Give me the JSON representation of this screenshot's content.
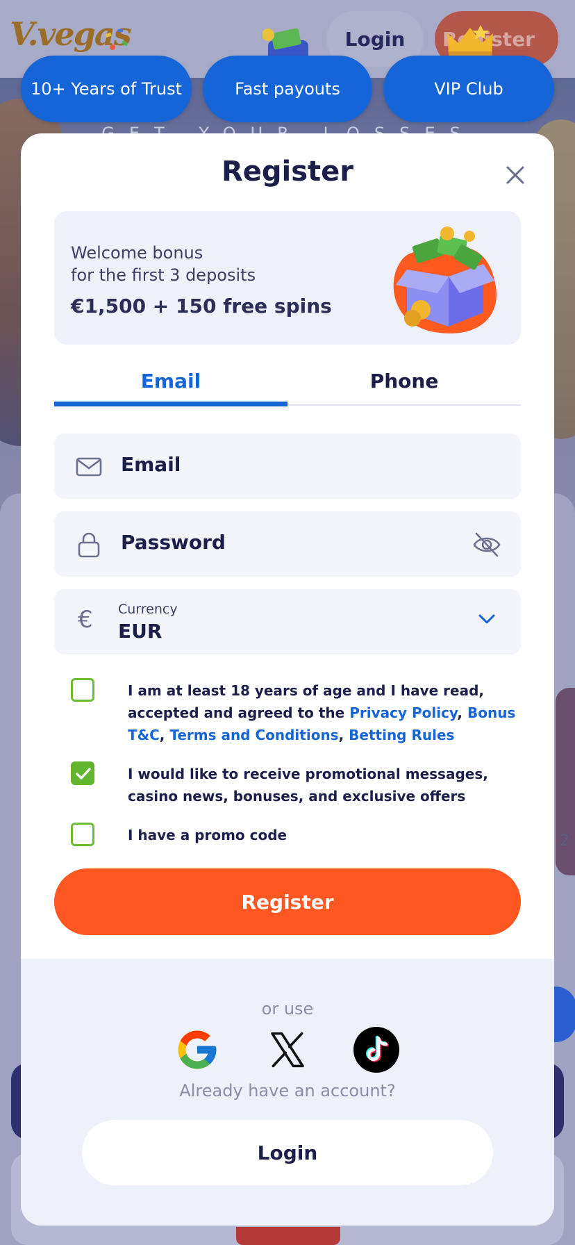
{
  "header": {
    "logo_text": "V.vegas",
    "login_label": "Login",
    "register_label": "Register"
  },
  "hero": {
    "banner_text": "GET YOUR LOSSES BACK"
  },
  "pills": [
    "10+ Years of Trust",
    "Fast payouts",
    "VIP Club"
  ],
  "modal": {
    "title": "Register",
    "bonus": {
      "line1": "Welcome bonus",
      "line2": "for the first 3 deposits",
      "amount": "€1,500 + 150 free spins"
    },
    "tabs": [
      {
        "label": "Email",
        "active": true
      },
      {
        "label": "Phone",
        "active": false
      }
    ],
    "email_placeholder": "Email",
    "password_placeholder": "Password",
    "currency": {
      "label": "Currency",
      "value": "EUR",
      "symbol": "€"
    },
    "checkboxes": {
      "age": {
        "checked": false,
        "text_before": "I am at least 18 years of age and I have read, accepted and agreed to the ",
        "link_privacy": "Privacy Policy",
        "link_bonus": "Bonus T&C",
        "link_terms": "Terms and Conditions",
        "link_betting": "Betting Rules"
      },
      "promo_messages": {
        "checked": true,
        "text": "I would like to receive promotional messages, casino news, bonuses, and exclusive offers"
      },
      "promo_code": {
        "checked": false,
        "text": "I have a promo code"
      }
    },
    "register_label": "Register",
    "or_use": "or use",
    "social": [
      "google-icon",
      "x-icon",
      "tiktok-icon"
    ],
    "already_text": "Already have an account?",
    "login_label": "Login"
  },
  "colors": {
    "primary_blue": "#1565d8",
    "register_orange": "#ff5722",
    "check_green": "#62b62e",
    "text_dark": "#1c1f4a"
  }
}
